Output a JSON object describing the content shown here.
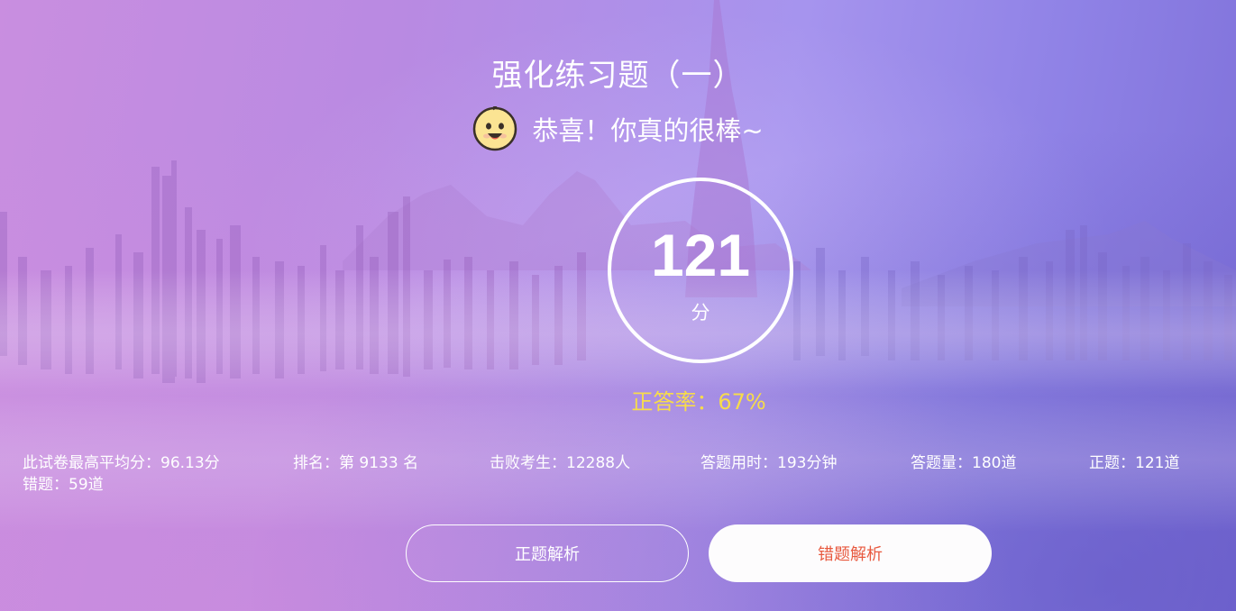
{
  "exam": {
    "title": "强化练习题（一）"
  },
  "result": {
    "message": "恭喜！你真的很棒~",
    "score": "121",
    "score_unit": "分",
    "accuracy_text": "正答率：67%",
    "accuracy_percent": 67
  },
  "stats": {
    "highest_average": "此试卷最高平均分：96.13分",
    "rank": "排名：第 9133 名",
    "defeated": "击败考生：12288人",
    "time_used": "答题用时：193分钟",
    "answered": "答题量：180道",
    "correct": "正题：121道",
    "wrong": "错题：59道"
  },
  "actions": {
    "correct_analysis": "正题解析",
    "wrong_analysis": "错题解析"
  },
  "icons": {
    "result_emoji": "smiling-face-icon"
  },
  "colors": {
    "accuracy": "#f7dc4a",
    "wrong_button_text": "#e8593f",
    "text": "#ffffff"
  }
}
